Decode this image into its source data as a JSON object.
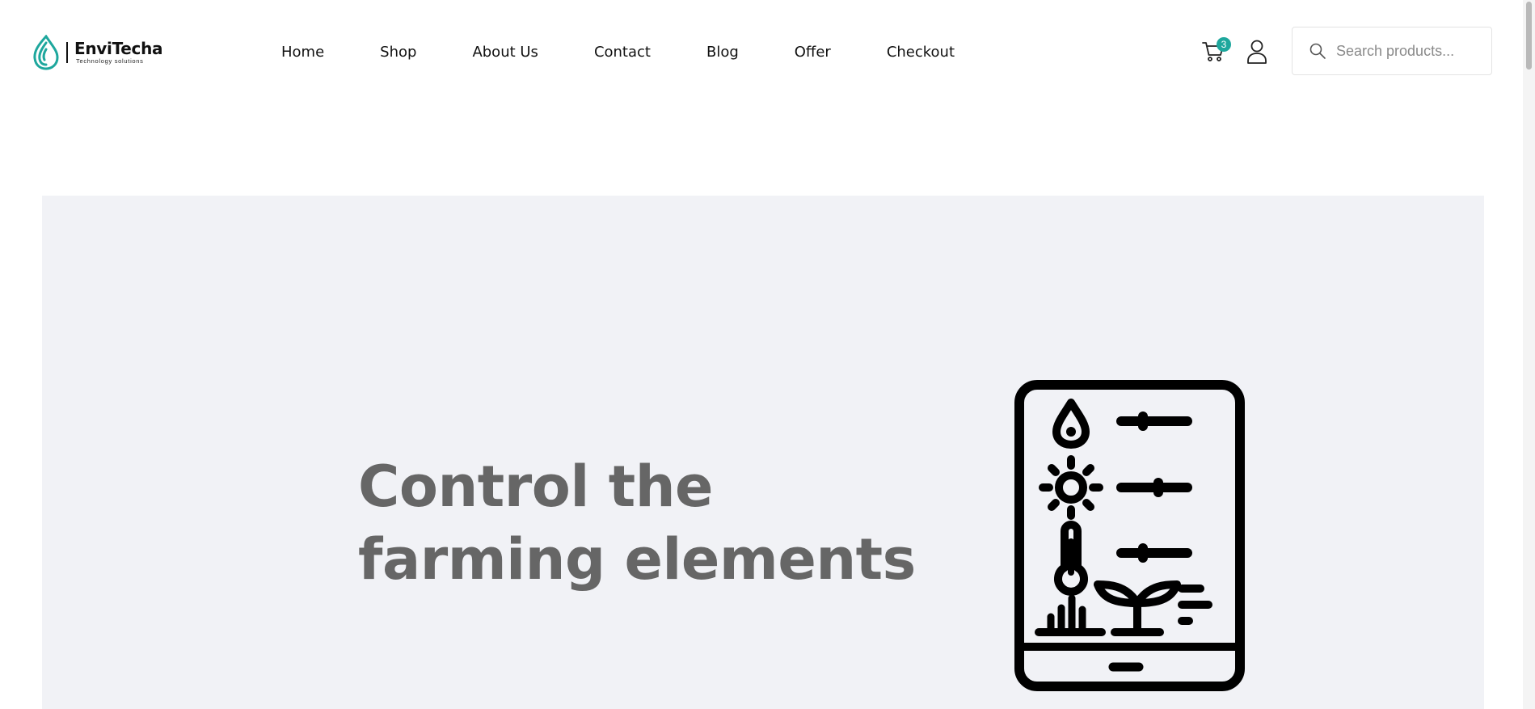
{
  "brand": {
    "name": "EnviTecha",
    "tagline": "Technology solutions",
    "accent_color": "#1ea79d",
    "logo_icon": "leaf-drop-logo-icon"
  },
  "nav": {
    "items": [
      {
        "label": "Home"
      },
      {
        "label": "Shop"
      },
      {
        "label": "About Us"
      },
      {
        "label": "Contact"
      },
      {
        "label": "Blog"
      },
      {
        "label": "Offer"
      },
      {
        "label": "Checkout"
      }
    ]
  },
  "header_icons": {
    "cart_icon": "cart-icon",
    "cart_count": "3",
    "user_icon": "user-icon"
  },
  "search": {
    "placeholder": "Search products...",
    "value": "",
    "icon": "search-icon"
  },
  "hero": {
    "title_line_1": "Control the",
    "title_line_2": "farming elements",
    "title_color": "#666666",
    "background_color": "#f1f2f6",
    "illustration_icon": "smart-farming-tablet-icon"
  }
}
